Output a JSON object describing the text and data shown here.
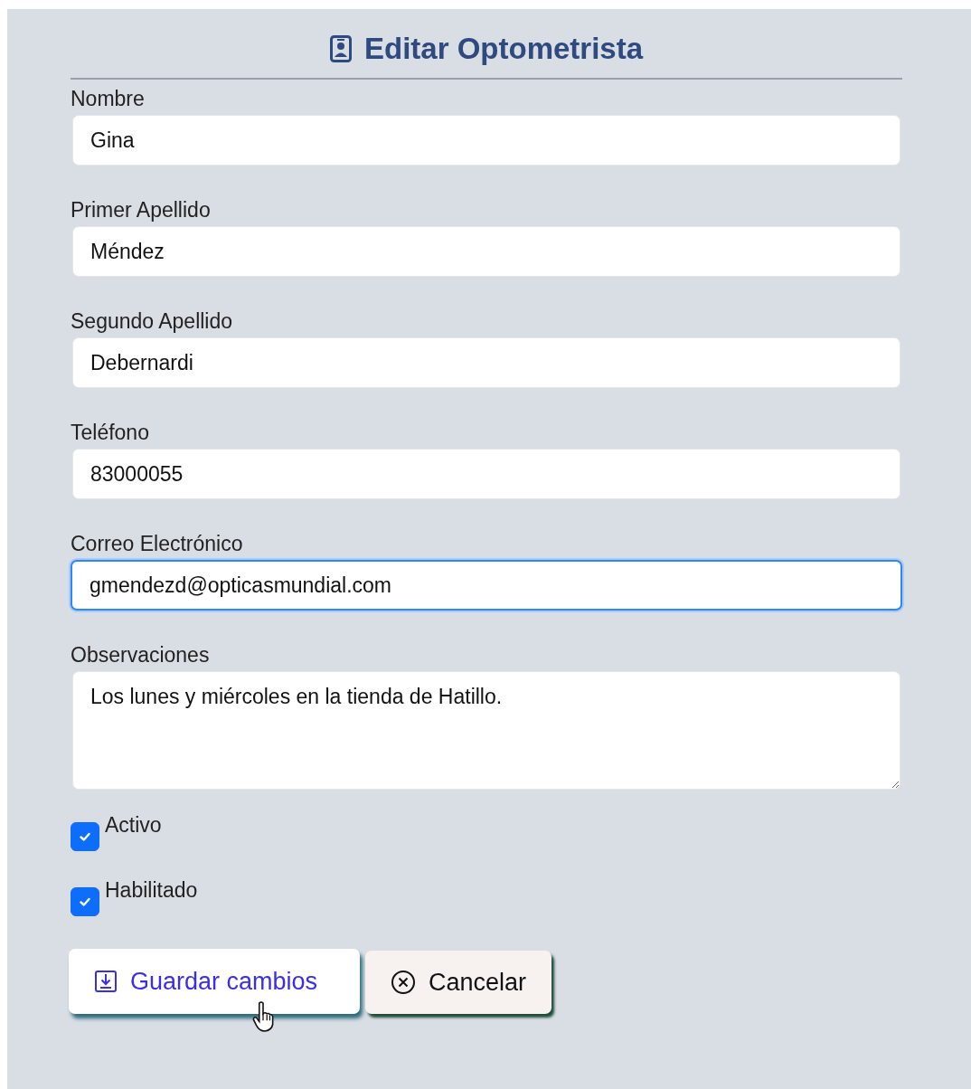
{
  "title": "Editar Optometrista",
  "fields": [
    {
      "label": "Nombre",
      "kind": "input",
      "value": "Gina",
      "focused": false
    },
    {
      "label": "Primer Apellido",
      "kind": "input",
      "value": "Méndez",
      "focused": false
    },
    {
      "label": "Segundo Apellido",
      "kind": "input",
      "value": "Debernardi",
      "focused": false
    },
    {
      "label": "Teléfono",
      "kind": "input",
      "value": "83000055",
      "focused": false
    },
    {
      "label": "Correo Electrónico",
      "kind": "input",
      "value": "gmendezd@opticasmundial.com",
      "focused": true
    },
    {
      "label": "Observaciones",
      "kind": "textarea",
      "value": "Los lunes y miércoles en la tienda de Hatillo.",
      "focused": false
    }
  ],
  "checkboxes": [
    {
      "label": "Activo",
      "checked": true
    },
    {
      "label": "Habilitado",
      "checked": true
    }
  ],
  "buttons": [
    {
      "label": "Guardar cambios",
      "kind": "save",
      "hovered": true
    },
    {
      "label": "Cancelar",
      "kind": "cancel",
      "hovered": false
    }
  ]
}
